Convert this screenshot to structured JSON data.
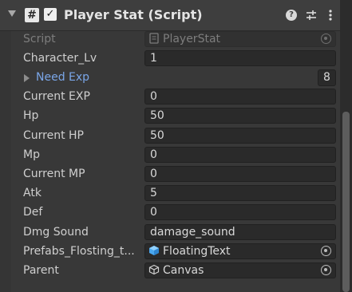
{
  "component": {
    "title": "Player Stat (Script)",
    "enabled": true,
    "icons": {
      "fold": "triangle-down-icon",
      "script": "script-hash-icon",
      "check": "checkmark-icon",
      "help": "help-icon",
      "presets": "presets-sliders-icon",
      "menu": "kebab-menu-icon"
    }
  },
  "fields": {
    "script": {
      "label": "Script",
      "value": "PlayerStat"
    },
    "character_lv": {
      "label": "Character_Lv",
      "value": "1"
    },
    "need_exp": {
      "label": "Need Exp",
      "size": "8"
    },
    "current_exp": {
      "label": "Current EXP",
      "value": "0"
    },
    "hp": {
      "label": "Hp",
      "value": "50"
    },
    "current_hp": {
      "label": "Current HP",
      "value": "50"
    },
    "mp": {
      "label": "Mp",
      "value": "0"
    },
    "current_mp": {
      "label": "Current MP",
      "value": "0"
    },
    "atk": {
      "label": "Atk",
      "value": "5"
    },
    "def": {
      "label": "Def",
      "value": "0"
    },
    "dmg_sound": {
      "label": "Dmg Sound",
      "value": "damage_sound"
    },
    "prefabs": {
      "label": "Prefabs_Flosting_t...",
      "value": "FloatingText"
    },
    "parent": {
      "label": "Parent",
      "value": "Canvas"
    }
  },
  "colors": {
    "background": "#383838",
    "field_bg": "#2a2a2a",
    "foldout_label": "#7aa6e8",
    "prefab_icon": "#4aa8f0"
  }
}
